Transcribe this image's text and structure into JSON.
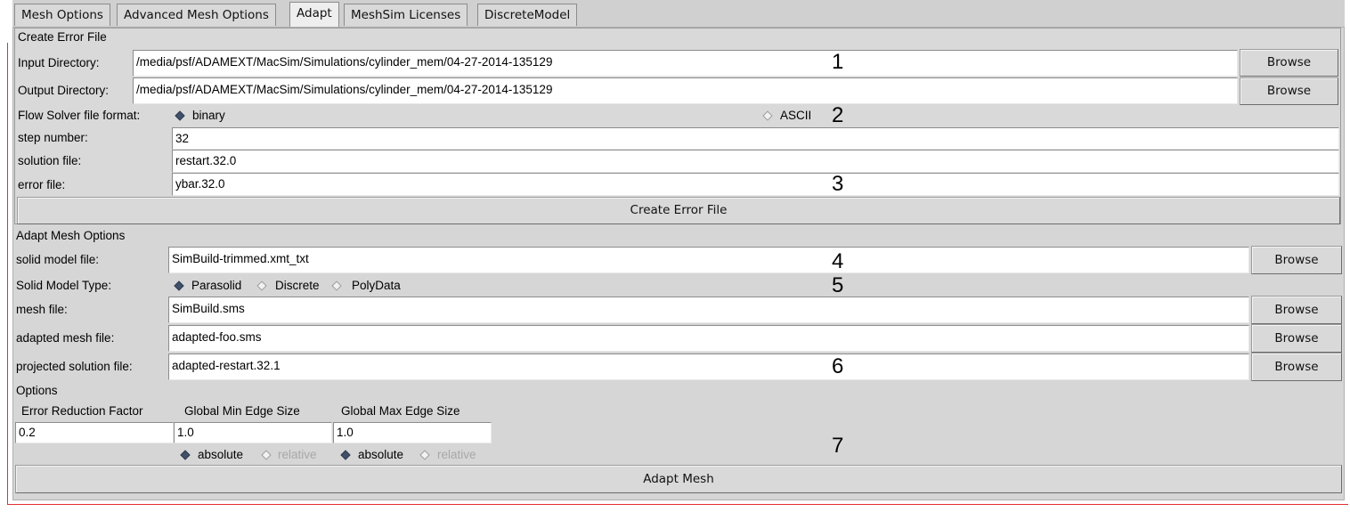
{
  "tabs": [
    {
      "label": "Mesh Options"
    },
    {
      "label": "Advanced Mesh Options"
    },
    {
      "label": "Adapt"
    },
    {
      "label": "MeshSim Licenses"
    },
    {
      "label": "DiscreteModel"
    }
  ],
  "create_error": {
    "title": "Create Error File",
    "input_dir_label": "Input Directory:",
    "input_dir_value": "/media/psf/ADAMEXT/MacSim/Simulations/cylinder_mem/04-27-2014-135129",
    "output_dir_label": "Output Directory:",
    "output_dir_value": "/media/psf/ADAMEXT/MacSim/Simulations/cylinder_mem/04-27-2014-135129",
    "browse_label": "Browse",
    "format_label": "Flow Solver file format:",
    "format_options": [
      {
        "label": "binary",
        "selected": true
      },
      {
        "label": "ASCII",
        "selected": false
      }
    ],
    "step_label": "step number:",
    "step_value": "32",
    "solution_label": "solution file:",
    "solution_value": "restart.32.0",
    "error_label": "error file:",
    "error_value": "ybar.32.0",
    "create_button": "Create Error File"
  },
  "adapt_mesh": {
    "title": "Adapt Mesh Options",
    "solid_model_label": "solid model file:",
    "solid_model_value": "SimBuild-trimmed.xmt_txt",
    "model_type_label": "Solid Model Type:",
    "model_type_options": [
      {
        "label": "Parasolid",
        "selected": true
      },
      {
        "label": "Discrete",
        "selected": false
      },
      {
        "label": "PolyData",
        "selected": false
      }
    ],
    "mesh_label": "mesh file:",
    "mesh_value": "SimBuild.sms",
    "adapted_label": "adapted mesh file:",
    "adapted_value": "adapted-foo.sms",
    "projected_label": "projected solution file:",
    "projected_value": "adapted-restart.32.1",
    "browse_label": "Browse"
  },
  "options": {
    "title": "Options",
    "headers": [
      "Error Reduction Factor",
      "Global Min Edge Size",
      "Global Max Edge Size"
    ],
    "values": [
      "0.2",
      "1.0",
      "1.0"
    ],
    "min_mode": [
      {
        "label": "absolute",
        "selected": true
      },
      {
        "label": "relative",
        "selected": false
      }
    ],
    "max_mode": [
      {
        "label": "absolute",
        "selected": true
      },
      {
        "label": "relative",
        "selected": false
      }
    ],
    "adapt_button": "Adapt Mesh"
  },
  "annotations": [
    "1",
    "2",
    "3",
    "4",
    "5",
    "6",
    "7"
  ]
}
